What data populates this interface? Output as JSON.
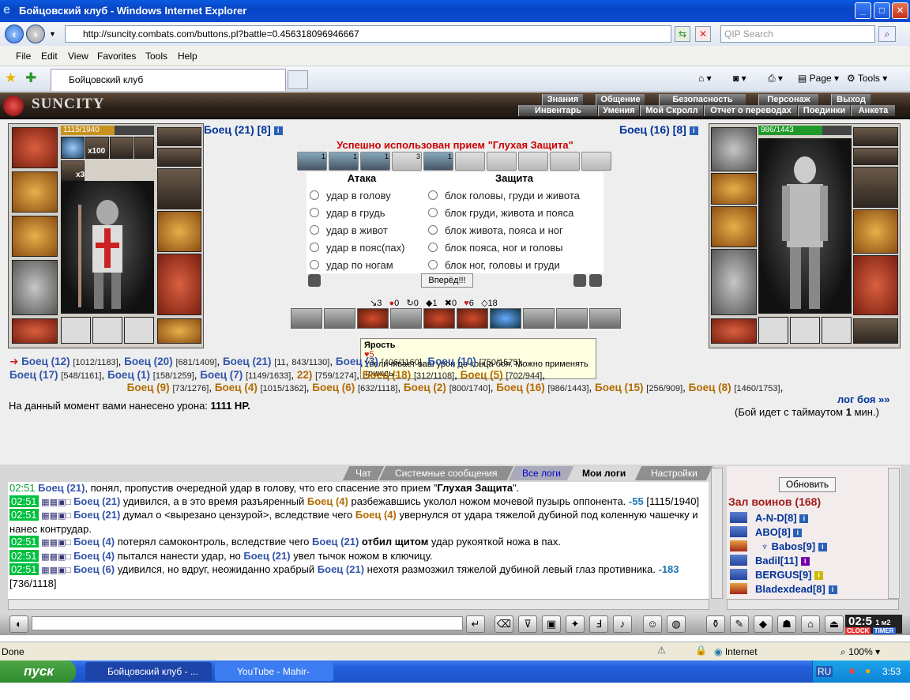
{
  "window": {
    "title": "Бойцовский клуб - Windows Internet Explorer",
    "min": "_",
    "max": "□",
    "close": "✕"
  },
  "address": {
    "url": "http://suncity.combats.com/buttons.pl?battle=0.456318096946667",
    "search_placeholder": "QIP Search"
  },
  "menu": [
    "File",
    "Edit",
    "View",
    "Favorites",
    "Tools",
    "Help"
  ],
  "tabs": {
    "active": "Бойцовский клуб"
  },
  "ie_tools": {
    "page": "Page",
    "tools": "Tools"
  },
  "game": {
    "logo": "SUNCITY",
    "menu_top": [
      "Знания",
      "Общение",
      "Безопасность",
      "Персонаж",
      "Выход"
    ],
    "menu_bottom": [
      "Инвентарь",
      "Умения",
      "Мой Скролл",
      "Отчет о переводах",
      "Поединки",
      "Анкета"
    ]
  },
  "left_fighter": {
    "name": "Боец (21) [8]",
    "hp": "1115/1940",
    "hp_fraction": 0.575,
    "badges": [
      "x100",
      "x3"
    ]
  },
  "right_fighter": {
    "name": "Боец (16) [8]",
    "hp": "986/1443",
    "hp_fraction": 0.683
  },
  "status_message": "Успешно использован прием \"Глухая Защита\"",
  "scroll_counts": [
    "1",
    "1",
    "1",
    "3",
    "1"
  ],
  "attack": {
    "header": "Атака",
    "options": [
      "удар в голову",
      "удар в грудь",
      "удар в живот",
      "удар в пояс(пах)",
      "удар по ногам"
    ]
  },
  "defense": {
    "header": "Защита",
    "options": [
      "блок головы, груди и живота",
      "блок груди, живота и пояса",
      "блок живота, пояса и ног",
      "блок пояса, ног и головы",
      "блок ног, головы и груди"
    ]
  },
  "forward_button": "Вперёд!!!",
  "battle_stats": [
    {
      "icon": "↘",
      "value": "3"
    },
    {
      "icon": "●",
      "value": "0"
    },
    {
      "icon": "↻",
      "value": "0"
    },
    {
      "icon": "◆",
      "value": "1"
    },
    {
      "icon": "✖",
      "value": "0"
    },
    {
      "icon": "♥",
      "value": "6"
    },
    {
      "icon": "◇",
      "value": "18"
    }
  ],
  "tooltip": {
    "title": "Ярость",
    "cost": "♥5",
    "text": "Увеличивает ваш урон до конца боя. Можно применять трижды."
  },
  "players_line1": [
    {
      "n": "Боец (12)",
      "hp": "[1012/1183]",
      "team": "b"
    },
    {
      "n": "Боец (20)",
      "hp": "[681/1409]",
      "team": "b"
    },
    {
      "n": "Боец (21)",
      "hp": "[11",
      "team": "b"
    },
    {
      "n": "",
      "hp": "843/1130]",
      "team": "b"
    },
    {
      "n": "Боец (3)",
      "hp": "[406/1160]",
      "team": "b"
    },
    {
      "n": "Боец (10)",
      "hp": "[750/1575]",
      "team": "b"
    }
  ],
  "players_line2": [
    {
      "n": "Боец (17)",
      "hp": "[548/1161]",
      "team": "b"
    },
    {
      "n": "Боец (1)",
      "hp": "[158/1259]",
      "team": "b"
    },
    {
      "n": "Боец (7)",
      "hp": "[1149/1633]",
      "team": "b"
    },
    {
      "n": "22)",
      "hp": "[759/1274]",
      "team": "o"
    },
    {
      "n": "Боец (18)",
      "hp": "[312/1108]",
      "team": "o"
    },
    {
      "n": "Боец (5)",
      "hp": "[702/944]",
      "team": "o"
    }
  ],
  "players_line3": [
    {
      "n": "Боец (9)",
      "hp": "[73/1276]",
      "team": "o"
    },
    {
      "n": "Боец (4)",
      "hp": "[1015/1362]",
      "team": "o"
    },
    {
      "n": "Боец (6)",
      "hp": "[632/1118]",
      "team": "o"
    },
    {
      "n": "Боец (2)",
      "hp": "[800/1740]",
      "team": "o"
    },
    {
      "n": "Боец (16)",
      "hp": "[986/1443]",
      "team": "o"
    },
    {
      "n": "Боец (15)",
      "hp": "[256/909]",
      "team": "o"
    },
    {
      "n": "Боец (8)",
      "hp": "[1460/1753]",
      "team": "o"
    }
  ],
  "damage": {
    "label": "На данный момент вами нанесено урона:",
    "value": "1111 HP."
  },
  "log_link": "лог боя »»",
  "timeout": {
    "pre": "(Бой идет с таймаутом",
    "value": "1",
    "post": "мин.)"
  },
  "chat_tabs": [
    "Чат",
    "Системные сообщения",
    "Все логи",
    "Мои логи",
    "Настройки"
  ],
  "chat": [
    {
      "time": "02:51",
      "a": "Боец (21)",
      "t1": ", понял, пропустив очередной удар в голову, что его спасение это прием \"",
      "b": "Глухая Защита",
      "t2": "\"."
    },
    {
      "time": "02:51",
      "a": "Боец (21)",
      "t1": " удивился, а в это время разъяренный ",
      "b": "Боец (4)",
      "t2": " разбежавшись уколол ножом мочевой пузырь оппонента.",
      "dmg": "-55",
      "hp": "[1115/1940]"
    },
    {
      "time": "02:51",
      "a": "Боец (21)",
      "t1": " думал о <вырезано цензурой>, вследствие чего ",
      "b": "Боец (4)",
      "t2": " увернулся от удара тяжелой дубиной под коленную чашечку и нанес контрудар."
    },
    {
      "time": "02:51",
      "a": "Боец (4)",
      "t1": " потерял самоконтроль, вследствие чего ",
      "b": "Боец (21)",
      "t2": " отбил щитом",
      "t3": " удар рукояткой ножа в пах."
    },
    {
      "time": "02:51",
      "a": "Боец (4)",
      "t1": " пытался нанести удар, но ",
      "b": "Боец (21)",
      "t2": " увел тычок ножом в ключицу."
    },
    {
      "time": "02:51",
      "a": "Боец (6)",
      "t1": " удивился, но вдруг, неожиданно храбрый ",
      "b": "Боец (21)",
      "t2": " нехотя размозжил тяжелой дубиной левый глаз противника.",
      "dmg": "-183",
      "hp": "[736/1118]"
    }
  ],
  "hall": {
    "refresh": "Обновить",
    "title": "Зал воинов (168)",
    "users": [
      "A-N-D[8]",
      "ABO[8]",
      "Babos[9]",
      "Badil[11]",
      "BERGUS[9]",
      "Bladexdead[8]"
    ]
  },
  "clock": {
    "time": "02:5",
    "small": "1 м2",
    "l1": "CLOCK",
    "l2": "TIMER"
  },
  "statusbar": {
    "left": "Done",
    "zone": "Internet",
    "zoom": "100%"
  },
  "taskbar": {
    "start": "пуск",
    "items": [
      "Бойцовский клуб - ...",
      "YouTube - Mahir-Elnu..."
    ],
    "lang": "RU",
    "time": "3:53"
  },
  "colors": {
    "team_blue": "#3355aa",
    "team_orange": "#b36b00",
    "status_red": "#cc0000"
  }
}
